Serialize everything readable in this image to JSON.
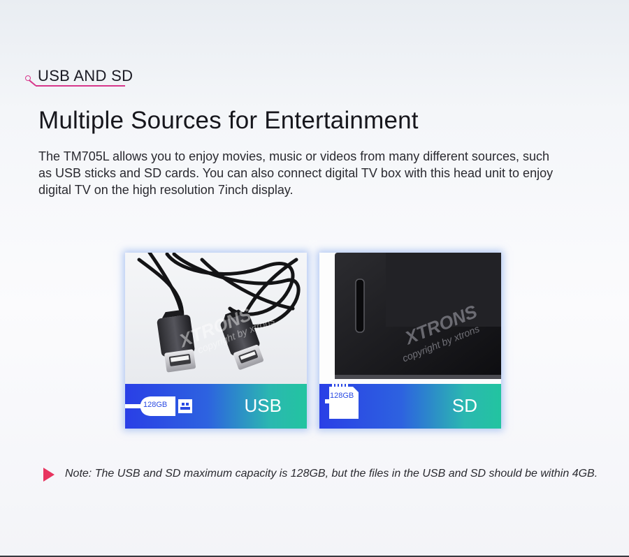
{
  "section_tag": "USB AND SD",
  "title": "Multiple Sources for Entertainment",
  "description": "The TM705L allows you to enjoy movies, music or videos from many different sources, such as USB sticks and SD cards.  You can also connect digital TV box with this head unit to enjoy digital TV on the high resolution 7inch display.",
  "cards": [
    {
      "label": "USB",
      "capacity": "128GB",
      "image": "usb-cable-photo"
    },
    {
      "label": "SD",
      "capacity": "128GB",
      "image": "head-unit-sd-slot-photo"
    }
  ],
  "watermark": {
    "brand": "XTRONS",
    "copyright": "copyright by xtrons"
  },
  "note": "Note: The USB and SD maximum capacity is 128GB, but the files in the USB and SD should be within 4GB.",
  "colors": {
    "accent_pink": "#d7388c",
    "note_arrow": "#e8345f",
    "band_start": "#2a3fe6",
    "band_end": "#22c4a0"
  }
}
